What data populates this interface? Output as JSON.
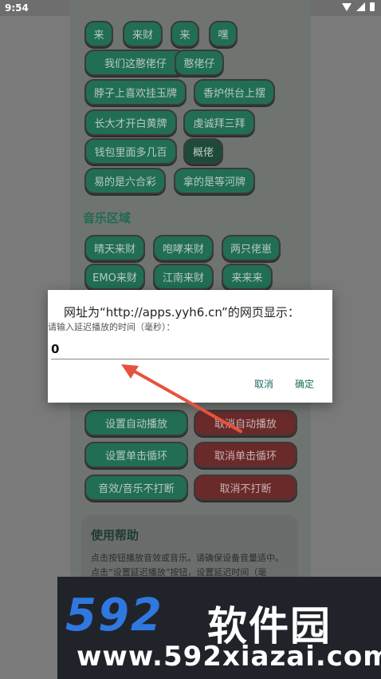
{
  "status_bar": {
    "time": "9:54"
  },
  "sound_buttons": [
    {
      "label": "来"
    },
    {
      "label": "来财"
    },
    {
      "label": "来"
    },
    {
      "label": "嘿"
    },
    {
      "label": "我们这憨佬仔"
    },
    {
      "label": "憨佬仔"
    },
    {
      "label": "脖子上喜欢挂玉牌"
    },
    {
      "label": "香炉供台上摆"
    },
    {
      "label": "长大才开白黄牌"
    },
    {
      "label": "虔诚拜三拜"
    },
    {
      "label": "钱包里面多几百"
    },
    {
      "label": "概佬"
    },
    {
      "label": "易的是六合彩"
    },
    {
      "label": "拿的是等河牌"
    }
  ],
  "music_section": {
    "title": "音乐区域",
    "buttons": [
      {
        "label": "晴天来财"
      },
      {
        "label": "咆哮来财"
      },
      {
        "label": "两只佬崽"
      },
      {
        "label": "EMO来财"
      },
      {
        "label": "江南来财"
      },
      {
        "label": "来来来"
      }
    ]
  },
  "controls": [
    {
      "label": "设置自动播放"
    },
    {
      "label": "取消自动播放"
    },
    {
      "label": "设置单击循环"
    },
    {
      "label": "取消单击循环"
    },
    {
      "label": "音效/音乐不打断"
    },
    {
      "label": "取消不打断"
    }
  ],
  "help": {
    "title": "使用帮助",
    "line1": "点击按钮播放音效或音乐。请确保设备音量适中。",
    "line2": "点击“设置延迟播放”按钮，设置延迟时间（毫"
  },
  "dialog": {
    "title": "网址为“http://apps.yyh6.cn”的网页显示：",
    "message": "请输入延迟播放的时间（毫秒）：",
    "input_value": "0",
    "cancel_label": "取消",
    "ok_label": "确定"
  },
  "watermark": {
    "logo_number": "592",
    "logo_text": "软件园",
    "url": "www.592xiazai.com"
  }
}
